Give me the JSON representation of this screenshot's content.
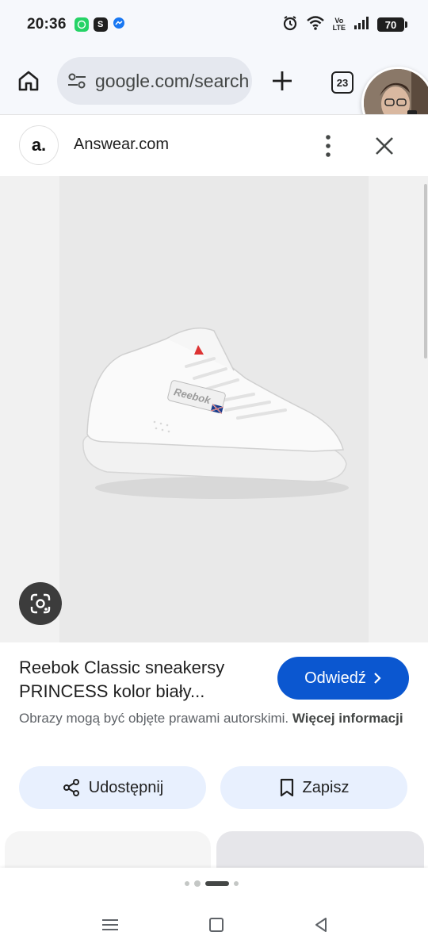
{
  "status_bar": {
    "time": "20:36",
    "battery": "70",
    "network_label_top": "Vo",
    "network_label_bottom": "LTE",
    "apps": [
      {
        "icon": "whatsapp-icon",
        "color": "#25d366",
        "glyph": "✆"
      },
      {
        "icon": "app-s-icon",
        "color": "#1f1f1f",
        "glyph": "S"
      },
      {
        "icon": "messenger-icon",
        "color": "#1877f2",
        "glyph": "⚡"
      }
    ]
  },
  "browser": {
    "url": "google.com/search",
    "tab_count": "23",
    "icons": [
      "home-icon",
      "tune-icon",
      "plus-icon",
      "tab-switcher-icon",
      "profile-avatar"
    ]
  },
  "site": {
    "logo_text": "a.",
    "name": "Answear.com"
  },
  "product": {
    "title": "Reebok Classic sneakersy PRINCESS kolor biały...",
    "visit_label": "Odwiedź",
    "copyright_text": "Obrazy mogą być objęte prawami autorskimi.",
    "more_info_label": "Więcej informacji",
    "share_label": "Udostępnij",
    "save_label": "Zapisz",
    "shoe_brand_text": "Reebok"
  },
  "colors": {
    "accent": "#0b57d0",
    "chip_bg": "#e8f0fe"
  }
}
